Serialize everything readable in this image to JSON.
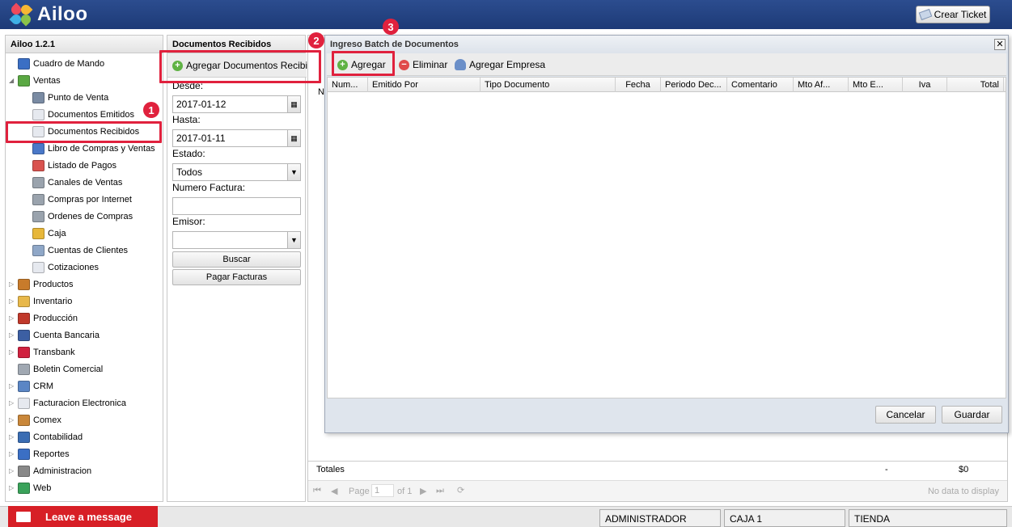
{
  "header": {
    "app_name": "Ailoo",
    "ticket_label": "Crear Ticket"
  },
  "sidebar": {
    "title": "Ailoo 1.2.1",
    "items": [
      {
        "label": "Cuadro de Mando",
        "icon": "chart-icon",
        "level": 0,
        "expander": ""
      },
      {
        "label": "Ventas",
        "icon": "ventas-icon",
        "level": 0,
        "expander": "open"
      },
      {
        "label": "Punto de Venta",
        "icon": "pos-icon",
        "level": 1,
        "expander": ""
      },
      {
        "label": "Documentos Emitidos",
        "icon": "document-icon",
        "level": 1,
        "expander": ""
      },
      {
        "label": "Documentos Recibidos",
        "icon": "document-icon",
        "level": 1,
        "expander": ""
      },
      {
        "label": "Libro de Compras y Ventas",
        "icon": "book-icon",
        "level": 1,
        "expander": ""
      },
      {
        "label": "Listado de Pagos",
        "icon": "payments-icon",
        "level": 1,
        "expander": ""
      },
      {
        "label": "Canales de Ventas",
        "icon": "cart-icon",
        "level": 1,
        "expander": ""
      },
      {
        "label": "Compras por Internet",
        "icon": "cart-icon",
        "level": 1,
        "expander": ""
      },
      {
        "label": "Ordenes de Compras",
        "icon": "cart-icon",
        "level": 1,
        "expander": ""
      },
      {
        "label": "Caja",
        "icon": "coins-icon",
        "level": 1,
        "expander": ""
      },
      {
        "label": "Cuentas de Clientes",
        "icon": "id-card-icon",
        "level": 1,
        "expander": ""
      },
      {
        "label": "Cotizaciones",
        "icon": "document-icon",
        "level": 1,
        "expander": ""
      },
      {
        "label": "Productos",
        "icon": "box-icon",
        "level": 0,
        "expander": "closed"
      },
      {
        "label": "Inventario",
        "icon": "cube-icon",
        "level": 0,
        "expander": "closed"
      },
      {
        "label": "Producción",
        "icon": "factory-icon",
        "level": 0,
        "expander": "closed"
      },
      {
        "label": "Cuenta Bancaria",
        "icon": "bank-icon",
        "level": 0,
        "expander": "closed"
      },
      {
        "label": "Transbank",
        "icon": "transbank-icon",
        "level": 0,
        "expander": "closed"
      },
      {
        "label": "Boletin Comercial",
        "icon": "tag-icon",
        "level": 0,
        "expander": ""
      },
      {
        "label": "CRM",
        "icon": "users-icon",
        "level": 0,
        "expander": "closed"
      },
      {
        "label": "Facturacion Electronica",
        "icon": "document-icon",
        "level": 0,
        "expander": "closed"
      },
      {
        "label": "Comex",
        "icon": "truck-icon",
        "level": 0,
        "expander": "closed"
      },
      {
        "label": "Contabilidad",
        "icon": "ledger-icon",
        "level": 0,
        "expander": "closed"
      },
      {
        "label": "Reportes",
        "icon": "bar-chart-icon",
        "level": 0,
        "expander": "closed"
      },
      {
        "label": "Administracion",
        "icon": "gear-icon",
        "level": 0,
        "expander": "closed"
      },
      {
        "label": "Web",
        "icon": "globe-icon",
        "level": 0,
        "expander": "closed"
      }
    ]
  },
  "mid_panel": {
    "title": "Documentos Recibidos",
    "add_button": "Agregar Documentos Recibidos",
    "desde_label": "Desde:",
    "desde_value": "2017-01-12",
    "hasta_label": "Hasta:",
    "hasta_value": "2017-01-11",
    "estado_label": "Estado:",
    "estado_value": "Todos",
    "numero_label": "Numero Factura:",
    "numero_value": "",
    "emisor_label": "Emisor:",
    "emisor_value": "",
    "buscar": "Buscar",
    "pagar": "Pagar Facturas"
  },
  "right_panel": {
    "partial_col": "N",
    "totales_label": "Totales",
    "totales_dash": "-",
    "totales_value": "$0",
    "pager_page_label": "Page",
    "pager_page_value": "1",
    "pager_of": "of 1",
    "pager_empty": "No data to display"
  },
  "dialog": {
    "title": "Ingreso Batch de Documentos",
    "close": "✕",
    "toolbar": {
      "add": "Agregar",
      "remove": "Eliminar",
      "add_company": "Agregar Empresa"
    },
    "columns": [
      "Num...",
      "Emitido Por",
      "Tipo Documento",
      "Fecha",
      "Periodo Dec...",
      "Comentario",
      "Mto Af...",
      "Mto E...",
      "Iva",
      "Total"
    ],
    "cancel": "Cancelar",
    "save": "Guardar"
  },
  "annotations": {
    "one": "1",
    "two": "2",
    "three": "3"
  },
  "footer": {
    "leave_message": "Leave a message",
    "user": "ADMINISTRADOR",
    "caja": "CAJA 1",
    "tienda": "TIENDA"
  },
  "colors": {
    "header_bg": "#1d3a77",
    "highlight": "#e0213d",
    "leave_bg": "#d71f26"
  }
}
